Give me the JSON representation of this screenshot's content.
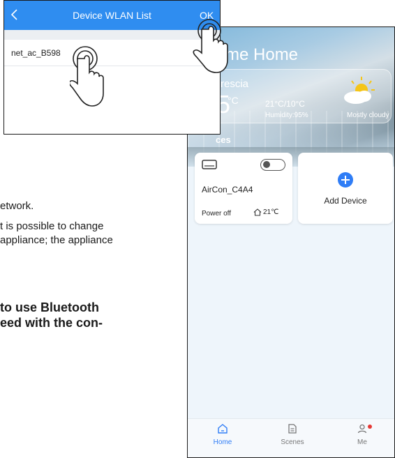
{
  "manual": {
    "line1": "etwork.",
    "line2": "t is possible to change",
    "line3": "appliance; the appliance",
    "bold1": "to use Bluetooth",
    "bold2": "eed with the con-"
  },
  "wlan": {
    "title": "Device WLAN List",
    "ok_label": "OK",
    "networks": [
      {
        "name": "net_ac_B598"
      }
    ]
  },
  "app": {
    "home_title": "me Home",
    "weather": {
      "city": "rescia",
      "temp": "5",
      "unit": "°C",
      "range": "21°C/10°C",
      "humidity": "Humidity:95%",
      "condition": "Mostly cloudy"
    },
    "section_label": "ces",
    "device": {
      "name": "AirCon_C4A4",
      "status": "Power off",
      "temp": "21℃",
      "power_on": false
    },
    "add_device_label": "Add Device",
    "tabs": [
      {
        "label": "Home",
        "active": true
      },
      {
        "label": "Scenes",
        "active": false
      },
      {
        "label": "Me",
        "active": false
      }
    ],
    "accent": "#2f7df6",
    "header_color": "#2f8df0",
    "notify_color": "#e53935"
  }
}
